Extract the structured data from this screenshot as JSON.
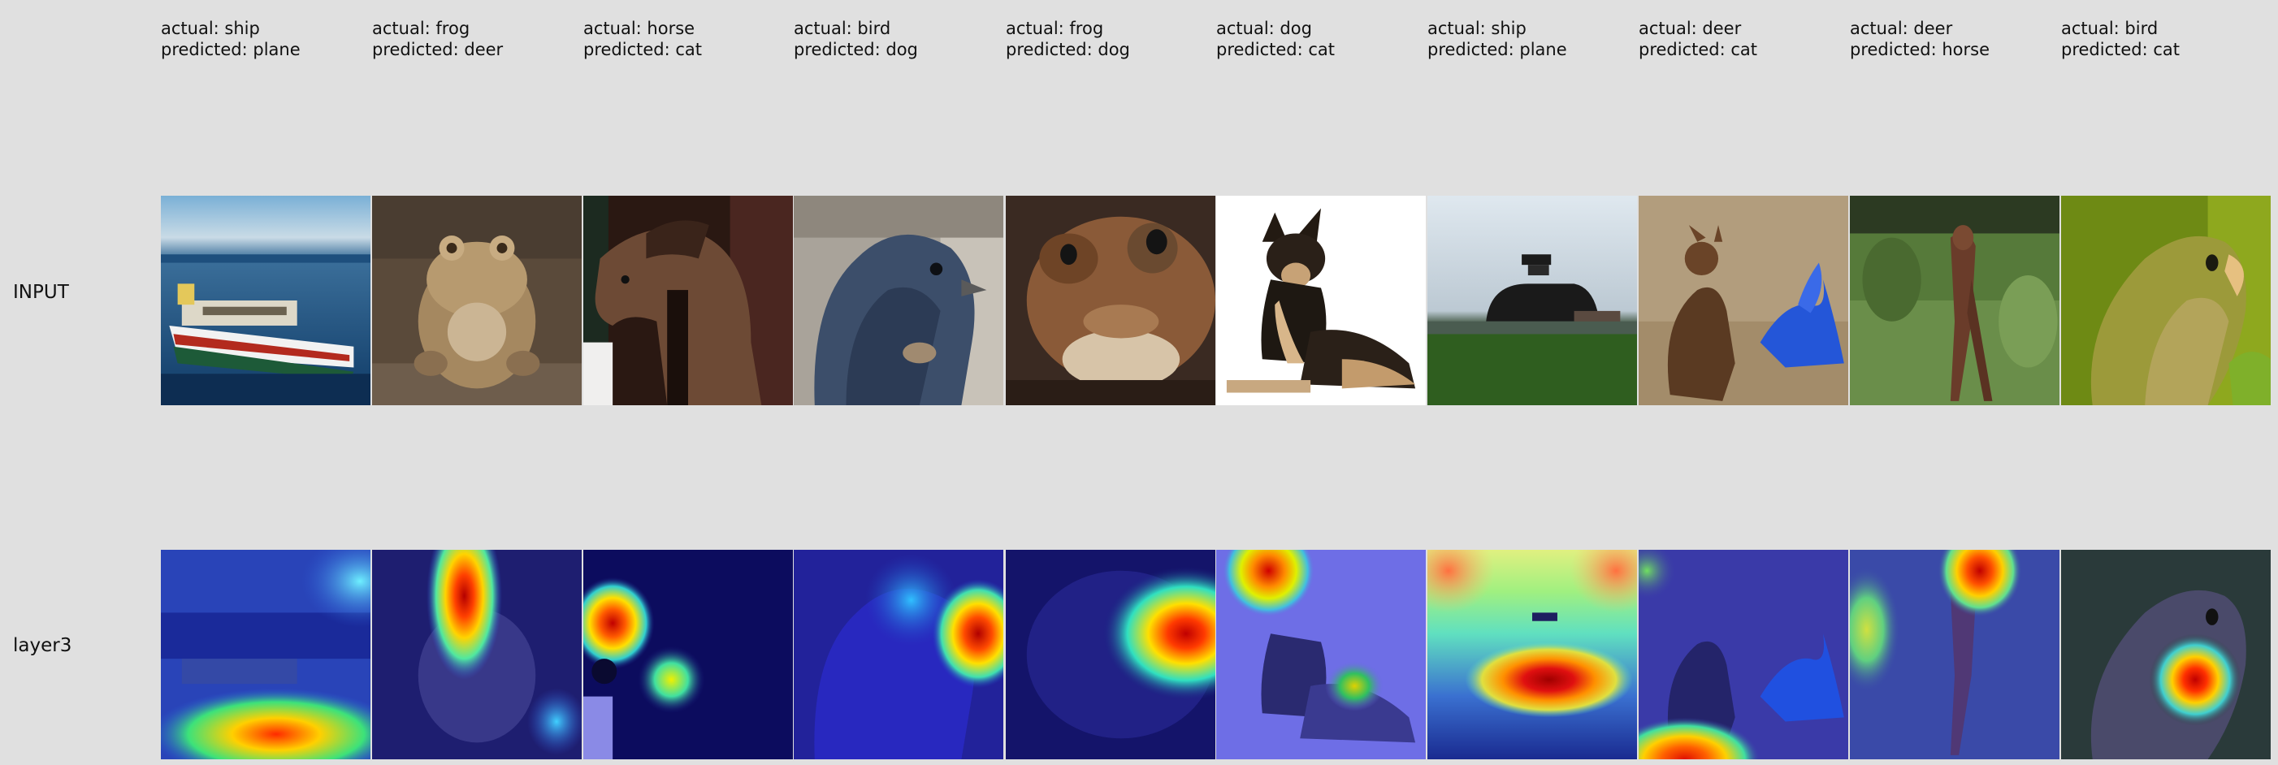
{
  "row_labels": {
    "input": "INPUT",
    "layer": "layer3"
  },
  "samples": [
    {
      "actual": "actual: ship",
      "predicted": "predicted: plane"
    },
    {
      "actual": "actual: frog",
      "predicted": "predicted: deer"
    },
    {
      "actual": "actual: horse",
      "predicted": "predicted: cat"
    },
    {
      "actual": "actual: bird",
      "predicted": "predicted: dog"
    },
    {
      "actual": "actual: frog",
      "predicted": "predicted: dog"
    },
    {
      "actual": "actual: dog",
      "predicted": "predicted: cat"
    },
    {
      "actual": "actual: ship",
      "predicted": "predicted: plane"
    },
    {
      "actual": "actual: deer",
      "predicted": "predicted: cat"
    },
    {
      "actual": "actual: deer",
      "predicted": "predicted: horse"
    },
    {
      "actual": "actual: bird",
      "predicted": "predicted: cat"
    }
  ]
}
